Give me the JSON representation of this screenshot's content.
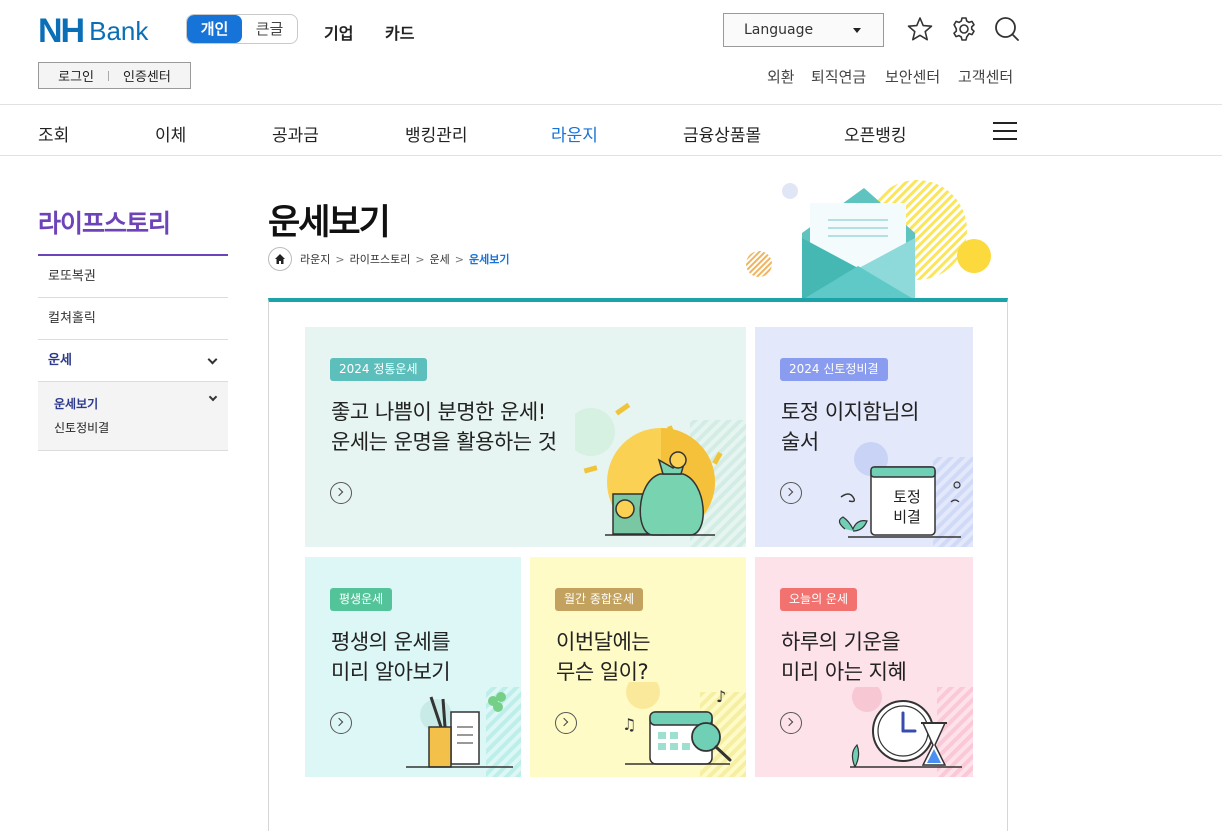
{
  "header": {
    "logo_nh": "NH",
    "logo_bank": "Bank",
    "mode_on": "개인",
    "mode_off": "큰글",
    "links": [
      "기업",
      "카드"
    ],
    "language_label": "Language",
    "login_label": "로그인",
    "cert_label": "인증센터",
    "util_links": [
      "외환",
      "퇴직연금",
      "보안센터",
      "고객센터"
    ]
  },
  "gnb": {
    "items": [
      "조회",
      "이체",
      "공과금",
      "뱅킹관리",
      "라운지",
      "금융상품몰",
      "오픈뱅킹"
    ],
    "active_index": 4
  },
  "lnb": {
    "title": "라이프스토리",
    "items": [
      "로또복권",
      "컬쳐홀릭",
      "운세"
    ],
    "sub_items": [
      "운세보기",
      "신토정비결"
    ]
  },
  "page": {
    "title": "운세보기",
    "breadcrumb": [
      "라운지",
      "라이프스토리",
      "운세",
      "운세보기"
    ]
  },
  "cards": [
    {
      "badge": "2024 정통운세",
      "badge_color": "#5cbfbc",
      "bg": "#e6f5f1",
      "lines": [
        "좋고 나쁨이 분명한 운세!",
        "운세는 운명을 활용하는 것"
      ]
    },
    {
      "badge": "2024 신토정비결",
      "badge_color": "#8a9cf0",
      "bg": "#e3e9fb",
      "lines": [
        "토정 이지함님의",
        "술서"
      ],
      "book_text": [
        "토정",
        "비결"
      ]
    },
    {
      "badge": "평생운세",
      "badge_color": "#53c49a",
      "bg": "#dcf7f6",
      "lines": [
        "평생의 운세를",
        "미리 알아보기"
      ]
    },
    {
      "badge": "월간 종합운세",
      "badge_color": "#c2a25e",
      "bg": "#fefbc6",
      "lines": [
        "이번달에는",
        "무슨 일이?"
      ]
    },
    {
      "badge": "오늘의 운세",
      "badge_color": "#f1726e",
      "bg": "#fde2ea",
      "lines": [
        "하루의 기운을",
        "미리 아는 지혜"
      ]
    }
  ],
  "colors": {
    "brand": "#0a6fb7",
    "accent": "#1673d8",
    "lnb_purple": "#6d43b8",
    "panel_top": "#1aa3a8"
  },
  "icons": {
    "favorite": "star-icon",
    "settings": "gear-icon",
    "search": "search-icon",
    "menu": "hamburger-icon",
    "home": "home-icon"
  }
}
